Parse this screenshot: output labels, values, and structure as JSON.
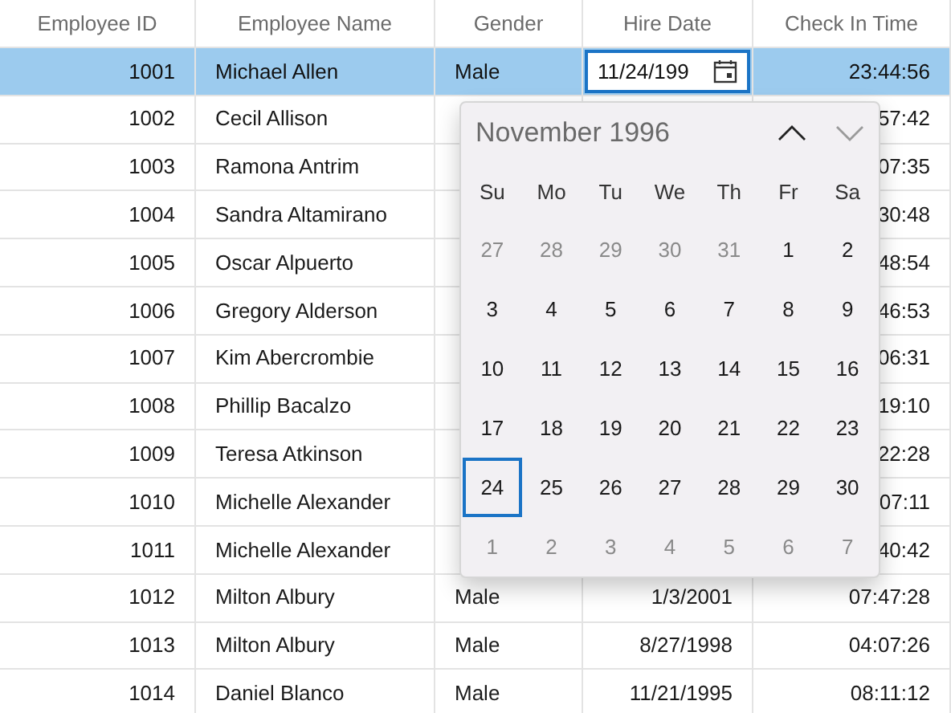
{
  "columns": [
    "Employee ID",
    "Employee Name",
    "Gender",
    "Hire Date",
    "Check In Time"
  ],
  "rows": [
    {
      "id": "1001",
      "name": "Michael Allen",
      "gender": "Male",
      "hire_date_editor": "11/24/199",
      "check_in": "23:44:56",
      "selected": true
    },
    {
      "id": "1002",
      "name": "Cecil Allison",
      "check_in": "57:42",
      "selected": false
    },
    {
      "id": "1003",
      "name": "Ramona Antrim",
      "check_in": "07:35",
      "selected": false
    },
    {
      "id": "1004",
      "name": "Sandra Altamirano",
      "check_in": "30:48",
      "selected": false
    },
    {
      "id": "1005",
      "name": "Oscar Alpuerto",
      "check_in": "48:54",
      "selected": false
    },
    {
      "id": "1006",
      "name": "Gregory Alderson",
      "check_in": "46:53",
      "selected": false
    },
    {
      "id": "1007",
      "name": "Kim Abercrombie",
      "check_in": "06:31",
      "selected": false
    },
    {
      "id": "1008",
      "name": "Phillip Bacalzo",
      "check_in": "19:10",
      "selected": false
    },
    {
      "id": "1009",
      "name": "Teresa Atkinson",
      "check_in": "22:28",
      "selected": false
    },
    {
      "id": "1010",
      "name": "Michelle Alexander",
      "check_in": "07:11",
      "selected": false
    },
    {
      "id": "1011",
      "name": "Michelle Alexander",
      "check_in": "40:42",
      "selected": false
    },
    {
      "id": "1012",
      "name": "Milton Albury",
      "gender": "Male",
      "hire_date": "1/3/2001",
      "check_in": "07:47:28",
      "selected": false
    },
    {
      "id": "1013",
      "name": "Milton Albury",
      "gender": "Male",
      "hire_date": "8/27/1998",
      "check_in": "04:07:26",
      "selected": false
    },
    {
      "id": "1014",
      "name": "Daniel Blanco",
      "gender": "Male",
      "hire_date": "11/21/1995",
      "check_in": "08:11:12",
      "selected": false
    }
  ],
  "calendar": {
    "title": "November 1996",
    "nav_buttons": [
      {
        "kind": "up",
        "disabled": false
      },
      {
        "kind": "down",
        "disabled": true
      }
    ],
    "weekdays": [
      "Su",
      "Mo",
      "Tu",
      "We",
      "Th",
      "Fr",
      "Sa"
    ],
    "weeks": [
      [
        {
          "label": "27",
          "other_month": true,
          "selected": false
        },
        {
          "label": "28",
          "other_month": true,
          "selected": false
        },
        {
          "label": "29",
          "other_month": true,
          "selected": false
        },
        {
          "label": "30",
          "other_month": true,
          "selected": false
        },
        {
          "label": "31",
          "other_month": true,
          "selected": false
        },
        {
          "label": "1",
          "other_month": false,
          "selected": false
        },
        {
          "label": "2",
          "other_month": false,
          "selected": false
        }
      ],
      [
        {
          "label": "3",
          "other_month": false,
          "selected": false
        },
        {
          "label": "4",
          "other_month": false,
          "selected": false
        },
        {
          "label": "5",
          "other_month": false,
          "selected": false
        },
        {
          "label": "6",
          "other_month": false,
          "selected": false
        },
        {
          "label": "7",
          "other_month": false,
          "selected": false
        },
        {
          "label": "8",
          "other_month": false,
          "selected": false
        },
        {
          "label": "9",
          "other_month": false,
          "selected": false
        }
      ],
      [
        {
          "label": "10",
          "other_month": false,
          "selected": false
        },
        {
          "label": "11",
          "other_month": false,
          "selected": false
        },
        {
          "label": "12",
          "other_month": false,
          "selected": false
        },
        {
          "label": "13",
          "other_month": false,
          "selected": false
        },
        {
          "label": "14",
          "other_month": false,
          "selected": false
        },
        {
          "label": "15",
          "other_month": false,
          "selected": false
        },
        {
          "label": "16",
          "other_month": false,
          "selected": false
        }
      ],
      [
        {
          "label": "17",
          "other_month": false,
          "selected": false
        },
        {
          "label": "18",
          "other_month": false,
          "selected": false
        },
        {
          "label": "19",
          "other_month": false,
          "selected": false
        },
        {
          "label": "20",
          "other_month": false,
          "selected": false
        },
        {
          "label": "21",
          "other_month": false,
          "selected": false
        },
        {
          "label": "22",
          "other_month": false,
          "selected": false
        },
        {
          "label": "23",
          "other_month": false,
          "selected": false
        }
      ],
      [
        {
          "label": "24",
          "other_month": false,
          "selected": true
        },
        {
          "label": "25",
          "other_month": false,
          "selected": false
        },
        {
          "label": "26",
          "other_month": false,
          "selected": false
        },
        {
          "label": "27",
          "other_month": false,
          "selected": false
        },
        {
          "label": "28",
          "other_month": false,
          "selected": false
        },
        {
          "label": "29",
          "other_month": false,
          "selected": false
        },
        {
          "label": "30",
          "other_month": false,
          "selected": false
        }
      ],
      [
        {
          "label": "1",
          "other_month": true,
          "selected": false
        },
        {
          "label": "2",
          "other_month": true,
          "selected": false
        },
        {
          "label": "3",
          "other_month": true,
          "selected": false
        },
        {
          "label": "4",
          "other_month": true,
          "selected": false
        },
        {
          "label": "5",
          "other_month": true,
          "selected": false
        },
        {
          "label": "6",
          "other_month": true,
          "selected": false
        },
        {
          "label": "7",
          "other_month": true,
          "selected": false
        }
      ]
    ]
  }
}
